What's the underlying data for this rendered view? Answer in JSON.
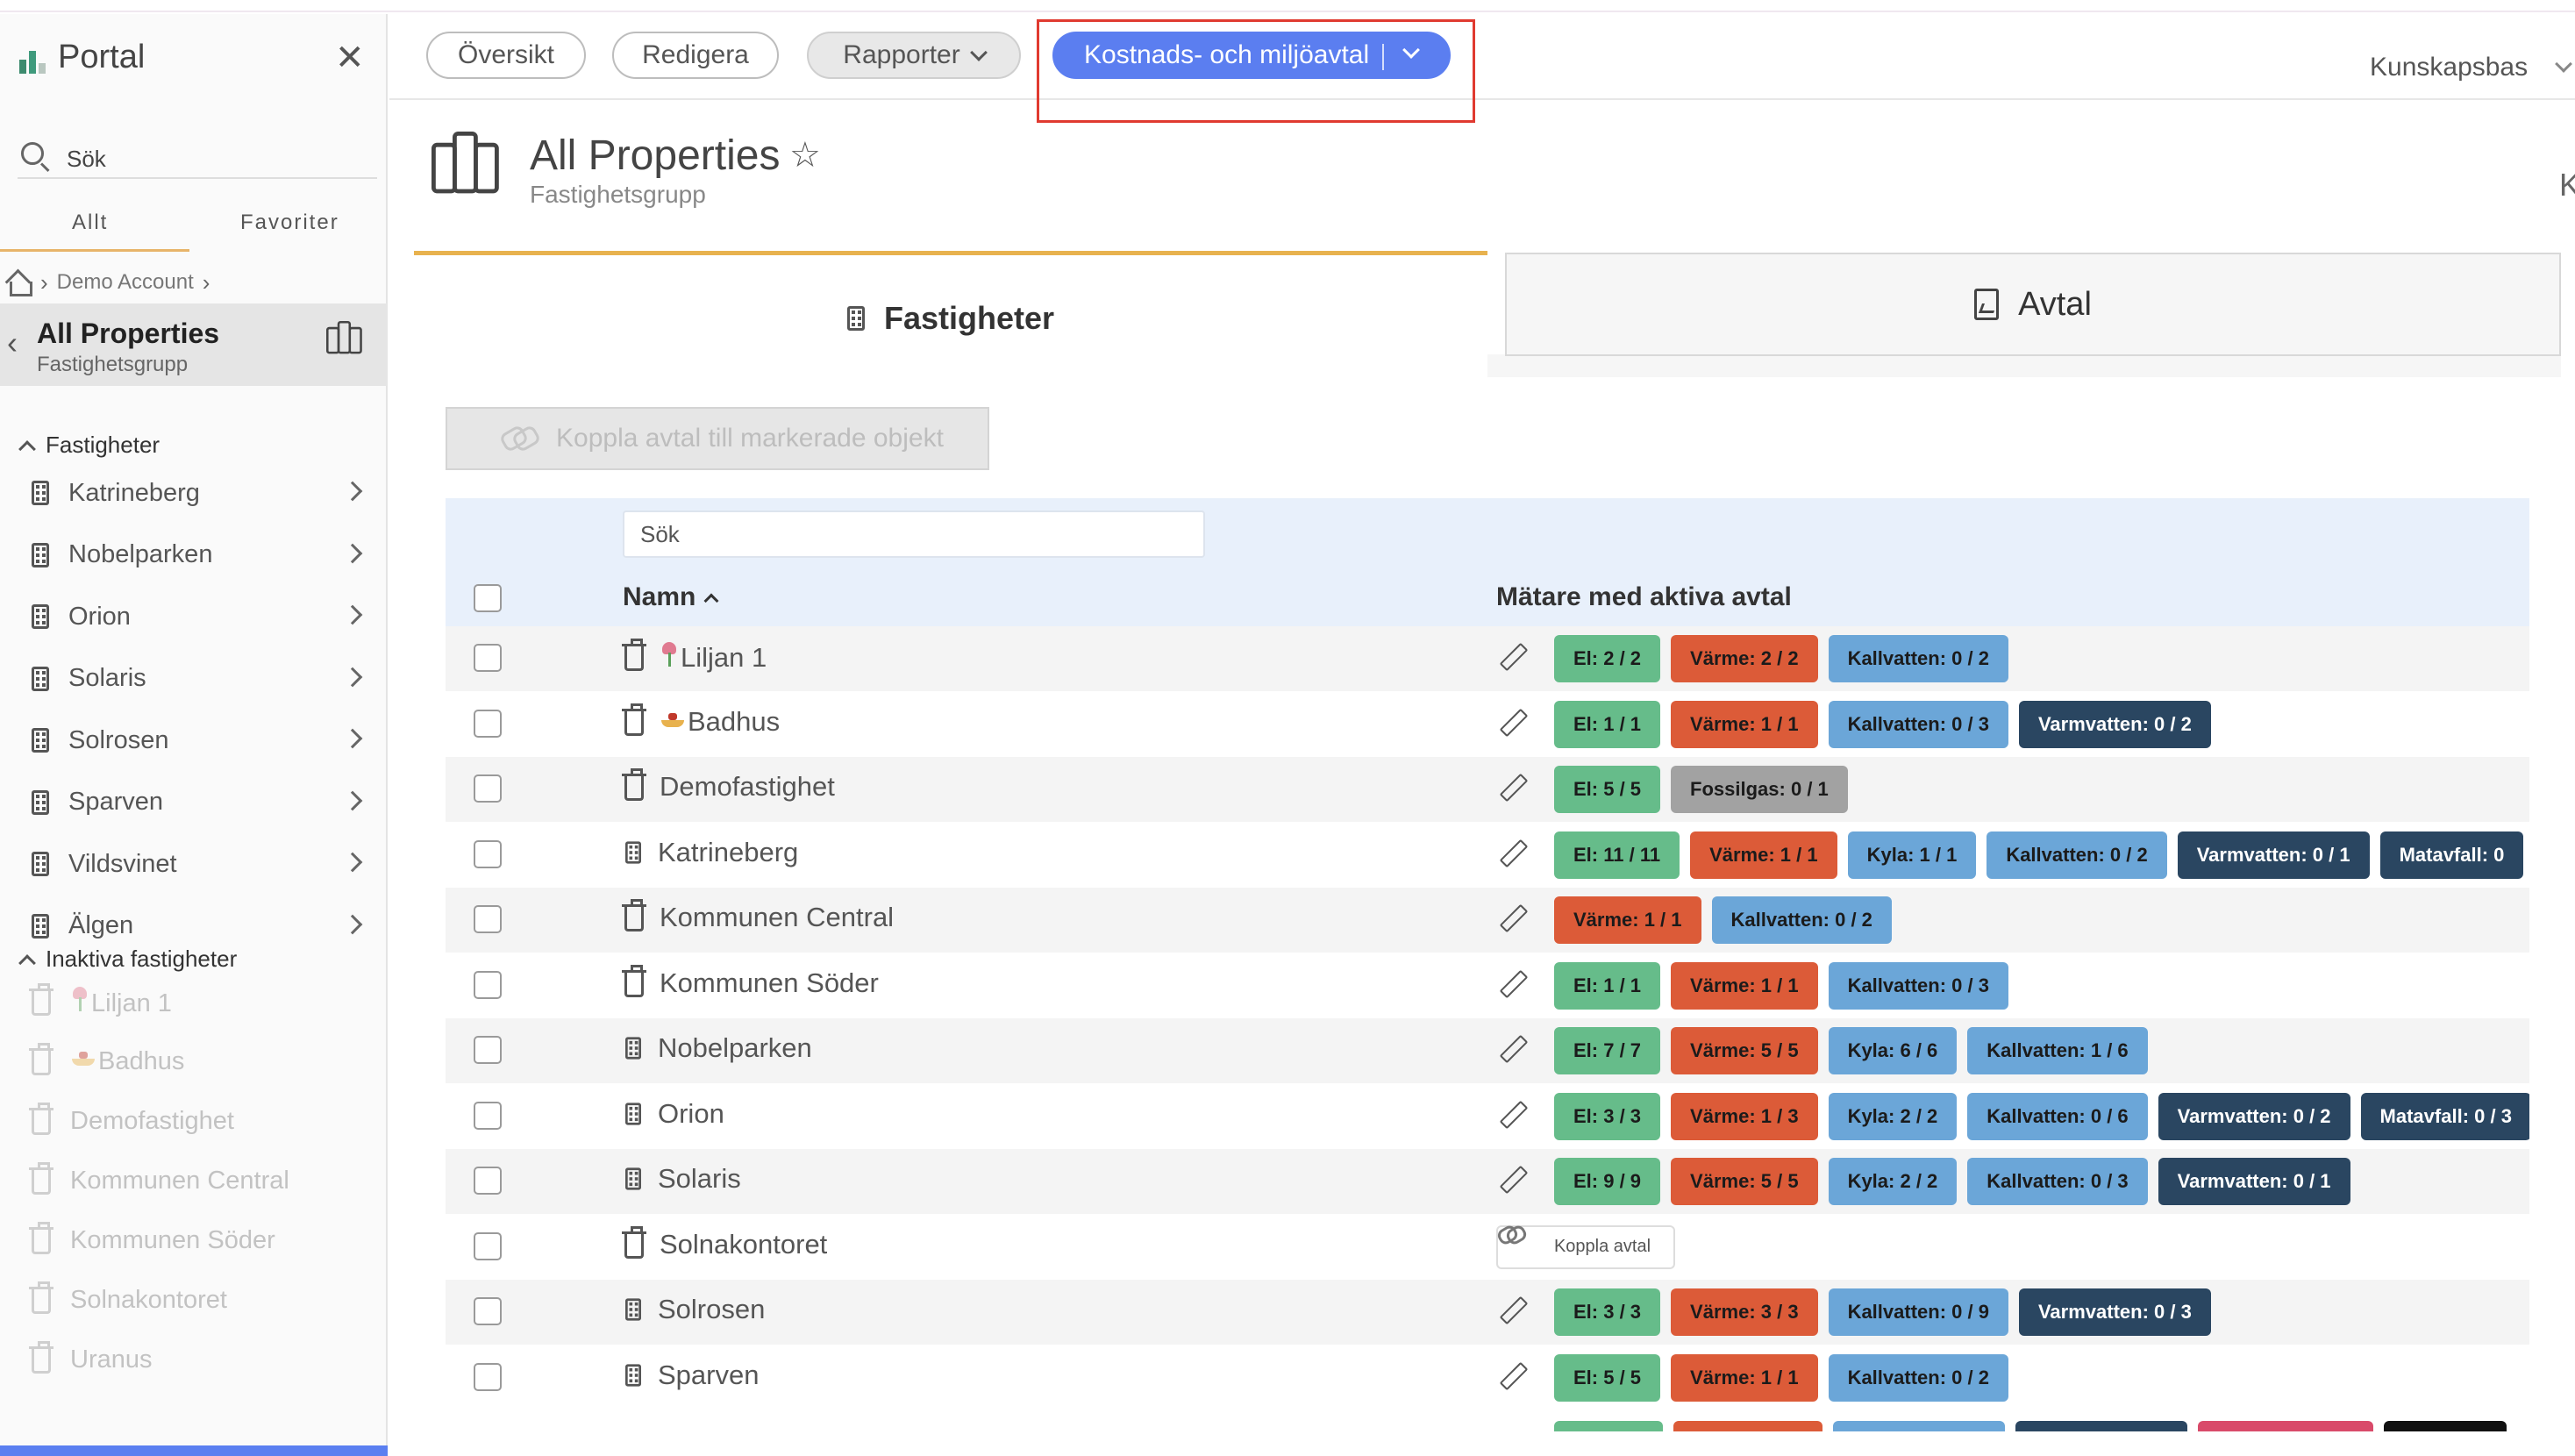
{
  "app": {
    "title": "Portal"
  },
  "sidebar": {
    "search_placeholder": "Sök",
    "tabs": [
      "Allt",
      "Favoriter"
    ],
    "breadcrumb": [
      "Demo Account"
    ],
    "selected": {
      "name": "All Properties",
      "type": "Fastighetsgrupp"
    },
    "active_group": {
      "label": "Fastigheter",
      "items": [
        "Katrineberg",
        "Nobelparken",
        "Orion",
        "Solaris",
        "Solrosen",
        "Sparven",
        "Vildsvinet",
        "Älgen"
      ]
    },
    "inactive_group": {
      "label": "Inaktiva fastigheter",
      "items": [
        "Liljan 1",
        "Badhus",
        "Demofastighet",
        "Kommunen Central",
        "Kommunen Söder",
        "Solnakontoret",
        "Uranus"
      ]
    }
  },
  "topnav": {
    "overview": "Översikt",
    "edit": "Redigera",
    "reports": "Rapporter",
    "agreements": "Kostnads- och miljöavtal",
    "knowledge": "Kunskapsbas"
  },
  "page": {
    "title": "All Properties",
    "subtitle": "Fastighetsgrupp"
  },
  "tabs": {
    "properties": "Fastigheter",
    "agreements": "Avtal"
  },
  "actions": {
    "link_agreement": "Koppla avtal till markerade objekt"
  },
  "table": {
    "search_placeholder": "Sök",
    "col_name": "Namn",
    "col_meters": "Mätare med aktiva avtal",
    "link_button": "Koppla avtal",
    "rows": [
      {
        "name": "Liljan 1",
        "icon": "trash-icon",
        "emoji": "tulip",
        "badges": [
          {
            "t": "El: 2 / 2",
            "k": "el"
          },
          {
            "t": "Värme: 2 / 2",
            "k": "varme"
          },
          {
            "t": "Kallvatten: 0 / 2",
            "k": "kall"
          }
        ]
      },
      {
        "name": "Badhus",
        "icon": "trash-icon",
        "emoji": "boat",
        "badges": [
          {
            "t": "El: 1 / 1",
            "k": "el"
          },
          {
            "t": "Värme: 1 / 1",
            "k": "varme"
          },
          {
            "t": "Kallvatten: 0 / 3",
            "k": "kall"
          },
          {
            "t": "Varmvatten: 0 / 2",
            "k": "varm"
          }
        ]
      },
      {
        "name": "Demofastighet",
        "icon": "trash-icon",
        "badges": [
          {
            "t": "El: 5 / 5",
            "k": "el"
          },
          {
            "t": "Fossilgas: 0 / 1",
            "k": "fossil"
          }
        ]
      },
      {
        "name": "Katrineberg",
        "icon": "building-icon",
        "badges": [
          {
            "t": "El: 11 / 11",
            "k": "el"
          },
          {
            "t": "Värme: 1 / 1",
            "k": "varme"
          },
          {
            "t": "Kyla: 1 / 1",
            "k": "kyla"
          },
          {
            "t": "Kallvatten: 0 / 2",
            "k": "kall"
          },
          {
            "t": "Varmvatten: 0 / 1",
            "k": "varm"
          },
          {
            "t": "Matavfall: 0",
            "k": "mat"
          }
        ]
      },
      {
        "name": "Kommunen Central",
        "icon": "trash-icon",
        "badges": [
          {
            "t": "Värme: 1 / 1",
            "k": "varme"
          },
          {
            "t": "Kallvatten: 0 / 2",
            "k": "kall"
          }
        ]
      },
      {
        "name": "Kommunen Söder",
        "icon": "trash-icon",
        "badges": [
          {
            "t": "El: 1 / 1",
            "k": "el"
          },
          {
            "t": "Värme: 1 / 1",
            "k": "varme"
          },
          {
            "t": "Kallvatten: 0 / 3",
            "k": "kall"
          }
        ]
      },
      {
        "name": "Nobelparken",
        "icon": "building-icon",
        "badges": [
          {
            "t": "El: 7 / 7",
            "k": "el"
          },
          {
            "t": "Värme: 5 / 5",
            "k": "varme"
          },
          {
            "t": "Kyla: 6 / 6",
            "k": "kyla"
          },
          {
            "t": "Kallvatten: 1 / 6",
            "k": "kall"
          }
        ]
      },
      {
        "name": "Orion",
        "icon": "building-icon",
        "badges": [
          {
            "t": "El: 3 / 3",
            "k": "el"
          },
          {
            "t": "Värme: 1 / 3",
            "k": "varme"
          },
          {
            "t": "Kyla: 2 / 2",
            "k": "kyla"
          },
          {
            "t": "Kallvatten: 0 / 6",
            "k": "kall"
          },
          {
            "t": "Varmvatten: 0 / 2",
            "k": "varm"
          },
          {
            "t": "Matavfall: 0 / 3",
            "k": "mat"
          }
        ]
      },
      {
        "name": "Solaris",
        "icon": "building-icon",
        "badges": [
          {
            "t": "El: 9 / 9",
            "k": "el"
          },
          {
            "t": "Värme: 5 / 5",
            "k": "varme"
          },
          {
            "t": "Kyla: 2 / 2",
            "k": "kyla"
          },
          {
            "t": "Kallvatten: 0 / 3",
            "k": "kall"
          },
          {
            "t": "Varmvatten: 0 / 1",
            "k": "varm"
          }
        ]
      },
      {
        "name": "Solnakontoret",
        "icon": "trash-icon",
        "badges": [],
        "no_agreement": true
      },
      {
        "name": "Solrosen",
        "icon": "building-icon",
        "badges": [
          {
            "t": "El: 3 / 3",
            "k": "el"
          },
          {
            "t": "Värme: 3 / 3",
            "k": "varme"
          },
          {
            "t": "Kallvatten: 0 / 9",
            "k": "kall"
          },
          {
            "t": "Varmvatten: 0 / 3",
            "k": "varm"
          }
        ]
      },
      {
        "name": "Sparven",
        "icon": "building-icon",
        "badges": [
          {
            "t": "El: 5 / 5",
            "k": "el"
          },
          {
            "t": "Värme: 1 / 1",
            "k": "varme"
          },
          {
            "t": "Kallvatten: 0 / 2",
            "k": "kall"
          }
        ]
      }
    ]
  },
  "colors": {
    "accent": "#5b7ef0",
    "tab_active": "#e8b24e",
    "el": "#66bc8a",
    "varme": "#dc5b38",
    "kall": "#6ba6d8",
    "varm": "#2a4661",
    "fossil": "#a2a2a2",
    "highlight": "#e03a30"
  }
}
